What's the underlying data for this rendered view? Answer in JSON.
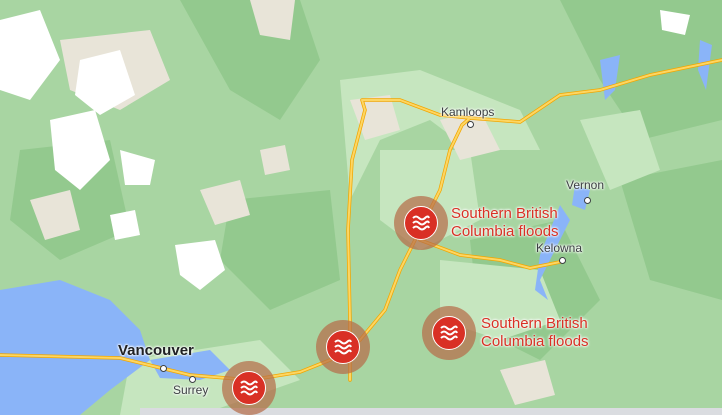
{
  "map": {
    "colors": {
      "forest": "#a8d5a2",
      "forest_dark": "#8fc68a",
      "valley": "#c9e7c2",
      "water": "#8ab4f8",
      "snow": "#ffffff",
      "bare": "#e9e2d6",
      "highway": "#fdd663",
      "highway_edge": "#f2a600",
      "event": "#d93025"
    },
    "cities": {
      "kamloops": "Kamloops",
      "vernon": "Vernon",
      "kelowna": "Kelowna",
      "vancouver": "Vancouver",
      "surrey": "Surrey"
    },
    "events": [
      {
        "title_line1": "Southern British",
        "title_line2": "Columbia floods",
        "icon": "flood-icon"
      },
      {
        "title_line1": "Southern British",
        "title_line2": "Columbia floods",
        "icon": "flood-icon"
      },
      {
        "icon": "flood-icon"
      },
      {
        "icon": "flood-icon"
      }
    ]
  }
}
